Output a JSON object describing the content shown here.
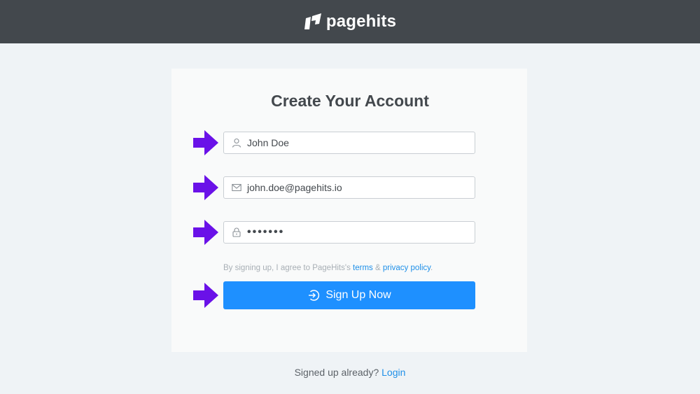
{
  "header": {
    "brand": "pagehits",
    "logo_icon": "pagehits-logo-icon",
    "background": "#43484d"
  },
  "form": {
    "title": "Create Your Account",
    "name_field": {
      "value": "John Doe",
      "icon": "user-icon"
    },
    "email_field": {
      "value": "john.doe@pagehits.io",
      "icon": "envelope-icon"
    },
    "password_field": {
      "value": "•••••••",
      "icon": "lock-icon"
    },
    "terms": {
      "prefix": "By signing up, I agree to PageHits's",
      "terms_link": "terms",
      "ampersand": "&",
      "privacy_link": "privacy policy",
      "suffix": "."
    },
    "submit": {
      "label": "Sign Up Now",
      "icon": "sign-in-icon",
      "color": "#1e90ff"
    }
  },
  "annotation": {
    "arrow_color": "#6a11e8",
    "arrow_icon": "arrow-right-icon"
  },
  "footer": {
    "prompt": "Signed up already?",
    "login_link": "Login"
  }
}
